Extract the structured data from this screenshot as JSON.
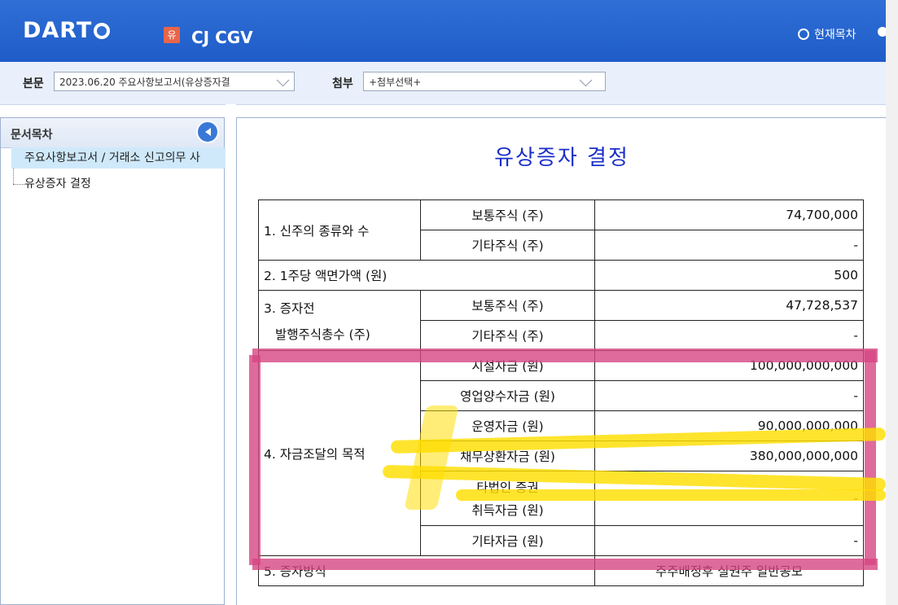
{
  "header": {
    "logo": "DART",
    "badge": "유",
    "company": "CJ CGV",
    "current_toc_label": "현재목차"
  },
  "subbar": {
    "main_label": "본문",
    "main_select": "2023.06.20  주요사항보고서(유상증자결",
    "attach_label": "첨부",
    "attach_select": "+첨부선택+"
  },
  "sidebar": {
    "title": "문서목차",
    "items": [
      {
        "label": "주요사항보고서 / 거래소 신고의무 사"
      },
      {
        "label": "유상증자 결정"
      }
    ]
  },
  "document": {
    "title": "유상증자 결정",
    "rows": [
      {
        "c1": "1. 신주의 종류와 수",
        "c2": "보통주식 (주)",
        "c3": "74,700,000"
      },
      {
        "c2": "기타주식 (주)",
        "c3": "-"
      },
      {
        "c1": "2. 1주당 액면가액 (원)",
        "c3": "500"
      },
      {
        "c1a": "3. 증자전",
        "c1b": "발행주식총수 (주)",
        "c2": "보통주식 (주)",
        "c3": "47,728,537"
      },
      {
        "c2": "기타주식 (주)",
        "c3": "-"
      },
      {
        "c1": "4. 자금조달의 목적",
        "c2": "시설자금 (원)",
        "c3": "100,000,000,000"
      },
      {
        "c2": "영업양수자금 (원)",
        "c3": "-"
      },
      {
        "c2": "운영자금 (원)",
        "c3": "90,000,000,000"
      },
      {
        "c2": "채무상환자금 (원)",
        "c3": "380,000,000,000"
      },
      {
        "c2a": "타법인 증권",
        "c2b": "취득자금 (원)",
        "c3": "-"
      },
      {
        "c2": "기타자금 (원)",
        "c3": "-"
      },
      {
        "c1": "5. 증자방식",
        "c3": "주주배정후 실권주 일반공모"
      }
    ]
  },
  "colors": {
    "header_blue": "#1f5cc8",
    "title_blue": "#1a2ec8",
    "highlight_pink": "#d64682",
    "highlight_yellow": "#ffde00"
  }
}
